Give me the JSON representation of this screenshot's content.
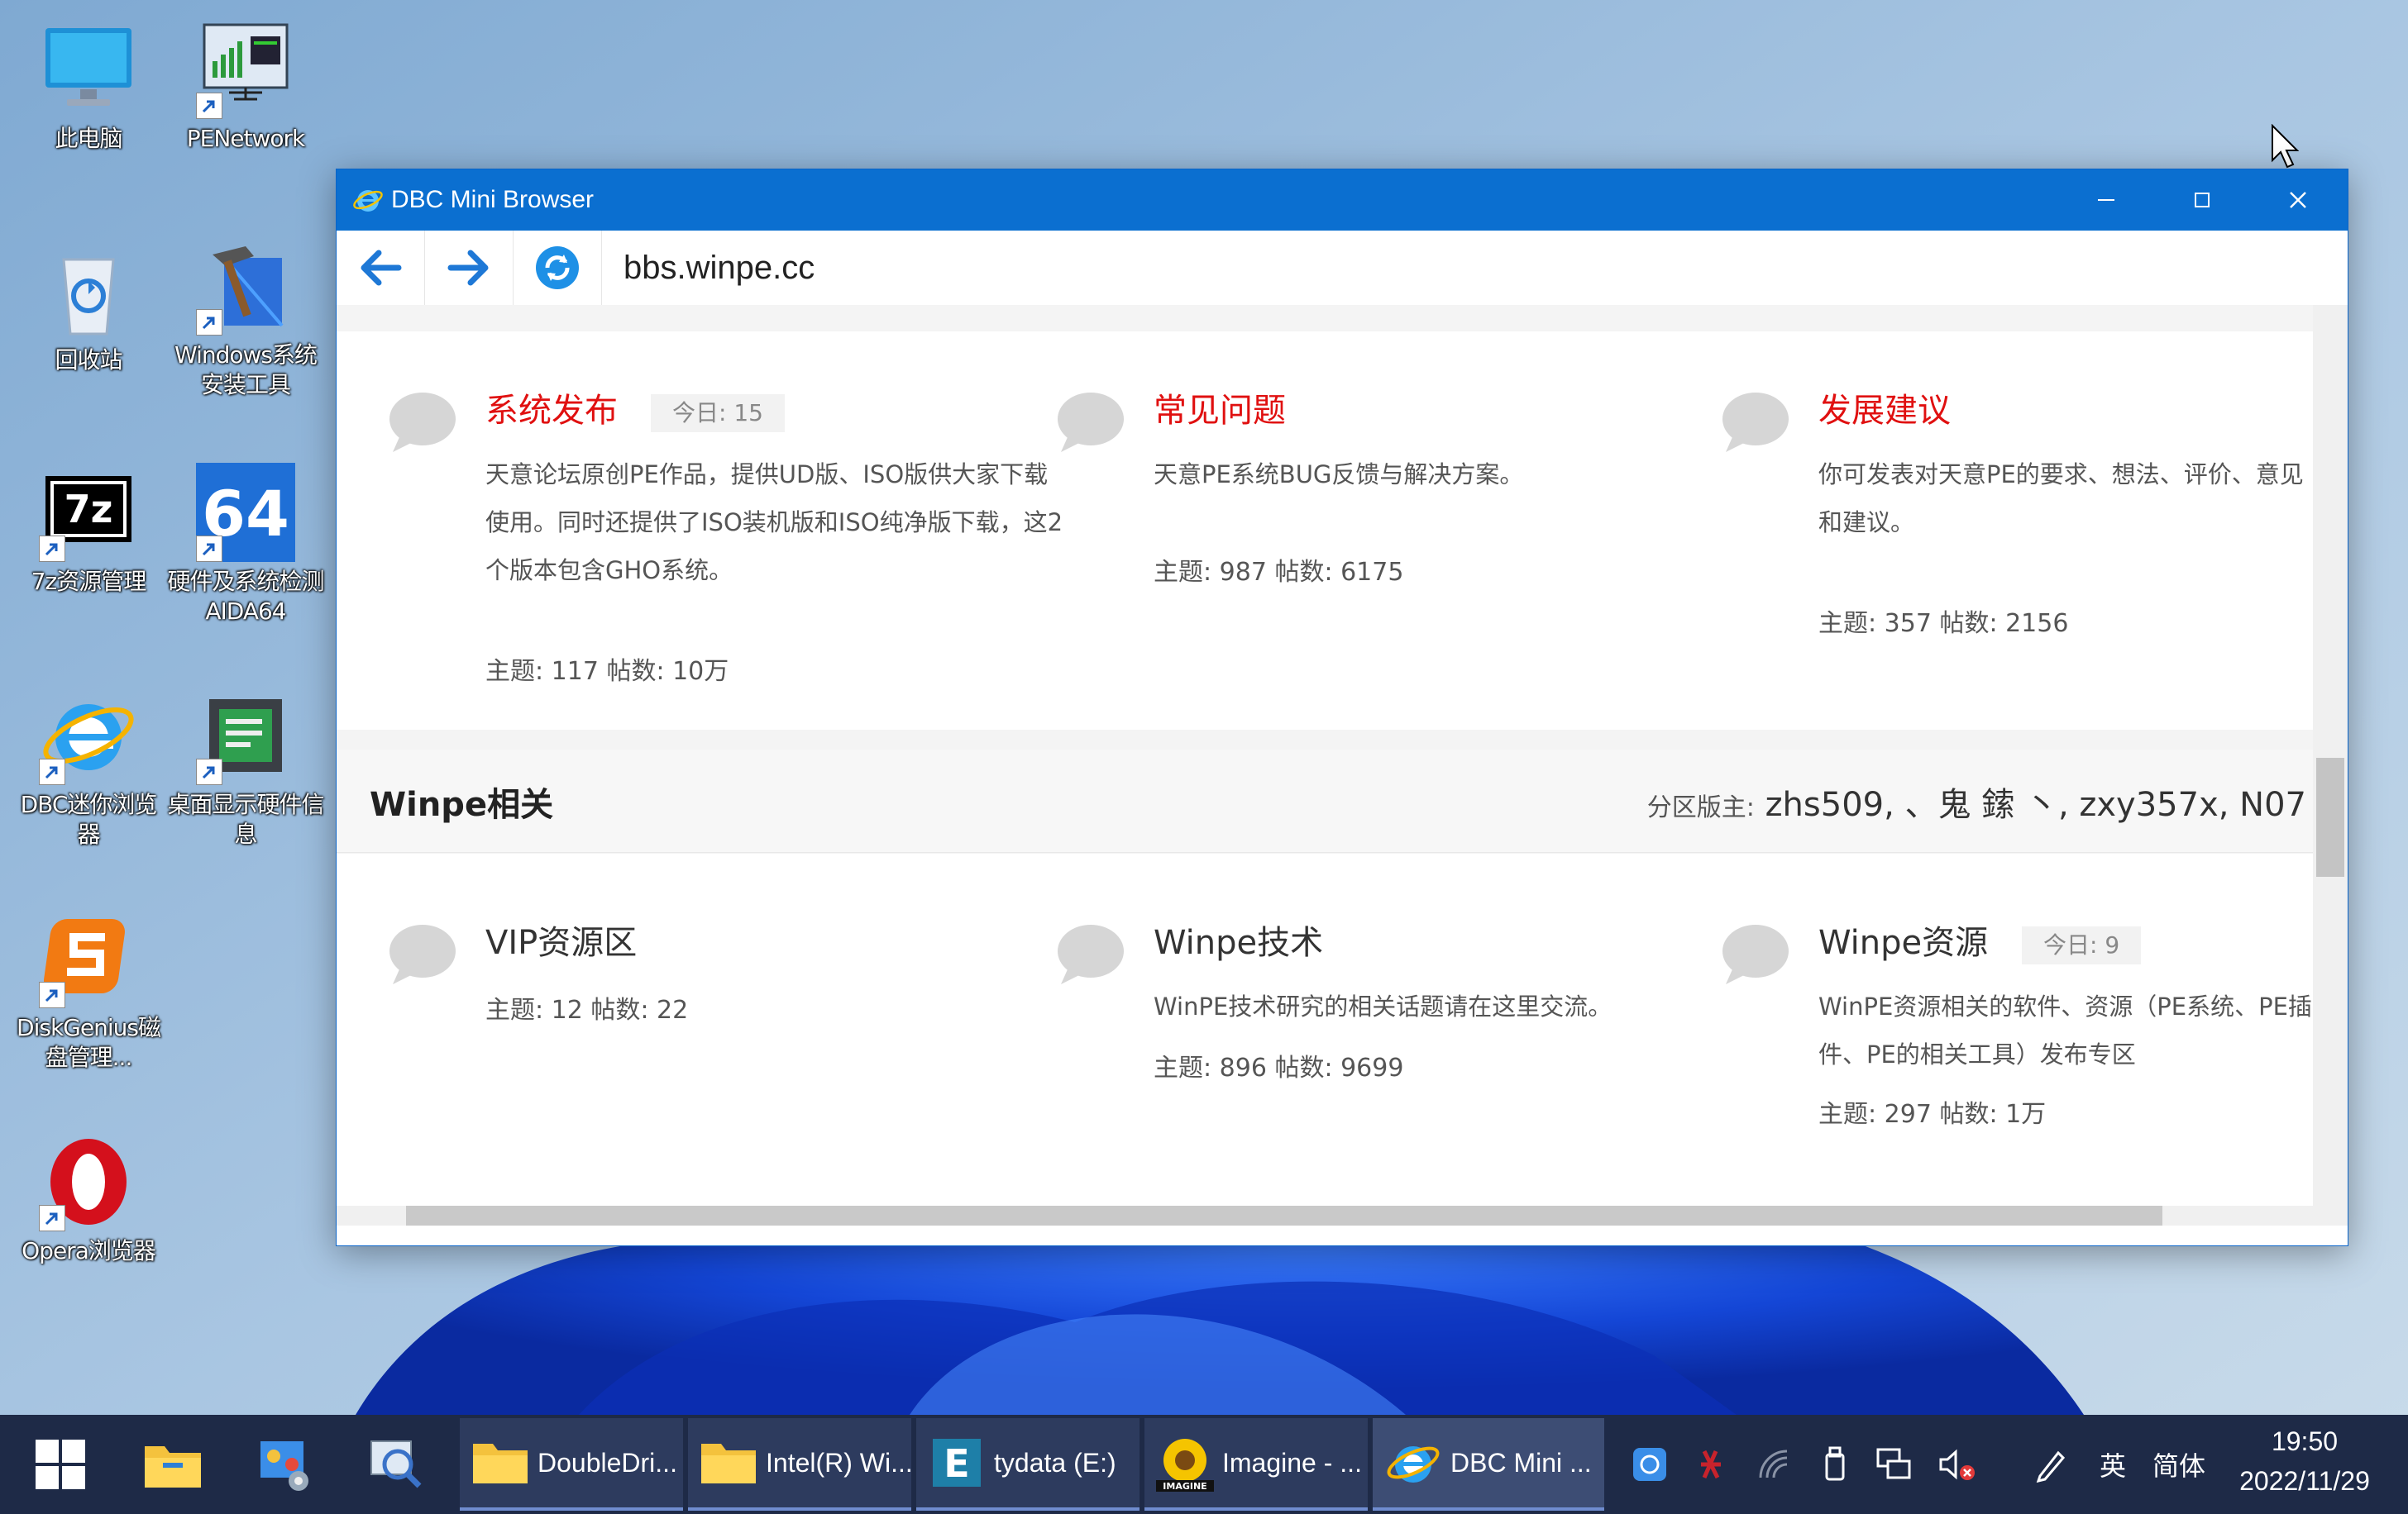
{
  "desktop": {
    "icons": [
      {
        "label": "此电脑"
      },
      {
        "label": "PENetwork"
      },
      {
        "label": "回收站"
      },
      {
        "label": "Windows系统安装工具"
      },
      {
        "label": "7z资源管理"
      },
      {
        "label": "硬件及系统检测 AIDA64"
      },
      {
        "label": "DBC迷你浏览器"
      },
      {
        "label": "桌面显示硬件信息"
      },
      {
        "label": "DiskGenius磁盘管理..."
      },
      {
        "label": "Opera浏览器"
      }
    ],
    "icon_glyphs": {
      "7z": "7z",
      "aida": "64"
    }
  },
  "window": {
    "title": "DBC Mini Browser",
    "address": "bbs.winpe.cc",
    "accent": "#0b6fd0"
  },
  "page": {
    "forums_top": [
      {
        "name": "系统发布",
        "today": "今日: 15",
        "desc": "天意论坛原创PE作品，提供UD版、ISO版供大家下载使用。同时还提供了ISO装机版和ISO纯净版下载，这2个版本包含GHO系统。",
        "stats": "主题: 117   帖数: 10万"
      },
      {
        "name": "常见问题",
        "desc": "天意PE系统BUG反馈与解决方案。",
        "stats": "主题: 987   帖数: 6175"
      },
      {
        "name": "发展建议",
        "desc": "你可发表对天意PE的要求、想法、评价、意见和建议。",
        "stats": "主题: 357   帖数: 2156"
      }
    ],
    "section": {
      "title": "Winpe相关",
      "moderators_label": "分区版主:",
      "moderators": "zhs509, 、鬼 鎍 丶, zxy357x, N07"
    },
    "forums_bottom": [
      {
        "name": "VIP资源区",
        "stats": "主题: 12   帖数: 22"
      },
      {
        "name": "Winpe技术",
        "desc": "WinPE技术研究的相关话题请在这里交流。",
        "stats": "主题: 896   帖数: 9699"
      },
      {
        "name": "Winpe资源",
        "today": "今日: 9",
        "desc": "WinPE资源相关的软件、资源（PE系统、PE插件、PE的相关工具）发布专区",
        "stats": "主题: 297   帖数: 1万"
      }
    ],
    "forum_name_color": "#e01010"
  },
  "taskbar": {
    "items": [
      {
        "label": "DoubleDri..."
      },
      {
        "label": "Intel(R) Wi..."
      },
      {
        "label": "tydata (E:)"
      },
      {
        "label": "Imagine - ..."
      },
      {
        "label": "DBC Mini ..."
      }
    ],
    "imagine_badge": "IMAGINE",
    "tydata_glyph": "E",
    "ime_lang": "英",
    "ime_mode": "简体",
    "time": "19:50",
    "date": "2022/11/29"
  }
}
